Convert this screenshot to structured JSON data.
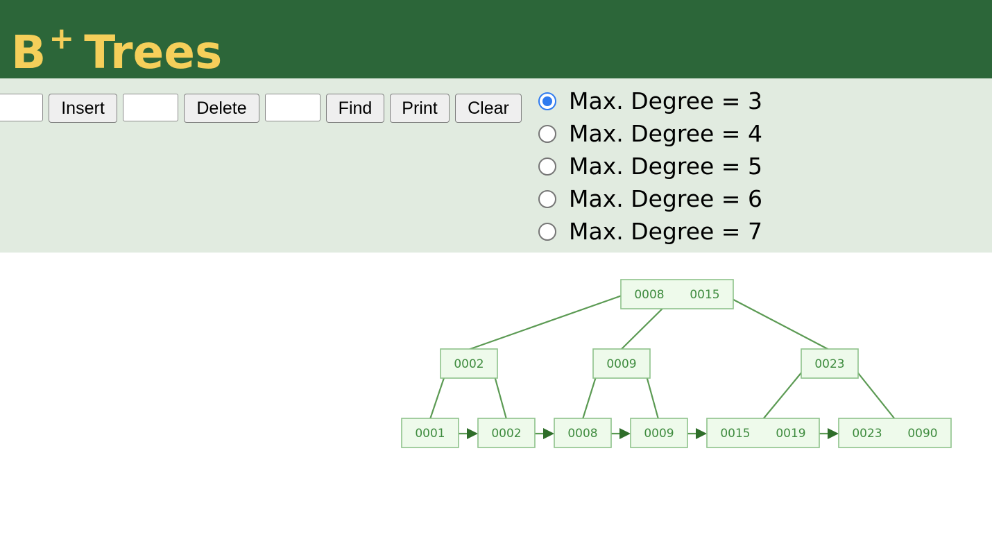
{
  "header": {
    "title_main": "B",
    "title_sup": "+",
    "title_rest": "Trees"
  },
  "controls": {
    "insert_input": "",
    "insert_label": "Insert",
    "delete_input": "",
    "delete_label": "Delete",
    "find_input": "",
    "find_label": "Find",
    "print_label": "Print",
    "clear_label": "Clear"
  },
  "degree_options": [
    {
      "label": "Max. Degree = 3",
      "checked": true
    },
    {
      "label": "Max. Degree = 4",
      "checked": false
    },
    {
      "label": "Max. Degree = 5",
      "checked": false
    },
    {
      "label": "Max. Degree = 6",
      "checked": false
    },
    {
      "label": "Max. Degree = 7",
      "checked": false
    }
  ],
  "tree": {
    "root": [
      "0008",
      "0015"
    ],
    "internal": [
      [
        "0002"
      ],
      [
        "0009"
      ],
      [
        "0023"
      ]
    ],
    "leaves": [
      [
        "0001"
      ],
      [
        "0002"
      ],
      [
        "0008"
      ],
      [
        "0009"
      ],
      [
        "0015",
        "0019"
      ],
      [
        "0023",
        "0090"
      ]
    ]
  },
  "colors": {
    "header_bg": "#2c6639",
    "title": "#f5cf5a",
    "controls_bg": "#e1ebe0",
    "node_fill": "#eefaeb",
    "node_stroke": "#8ec28a",
    "node_text": "#3e8b3e",
    "edge": "#5b9a53",
    "radio_checked": "#2f7bf0"
  }
}
